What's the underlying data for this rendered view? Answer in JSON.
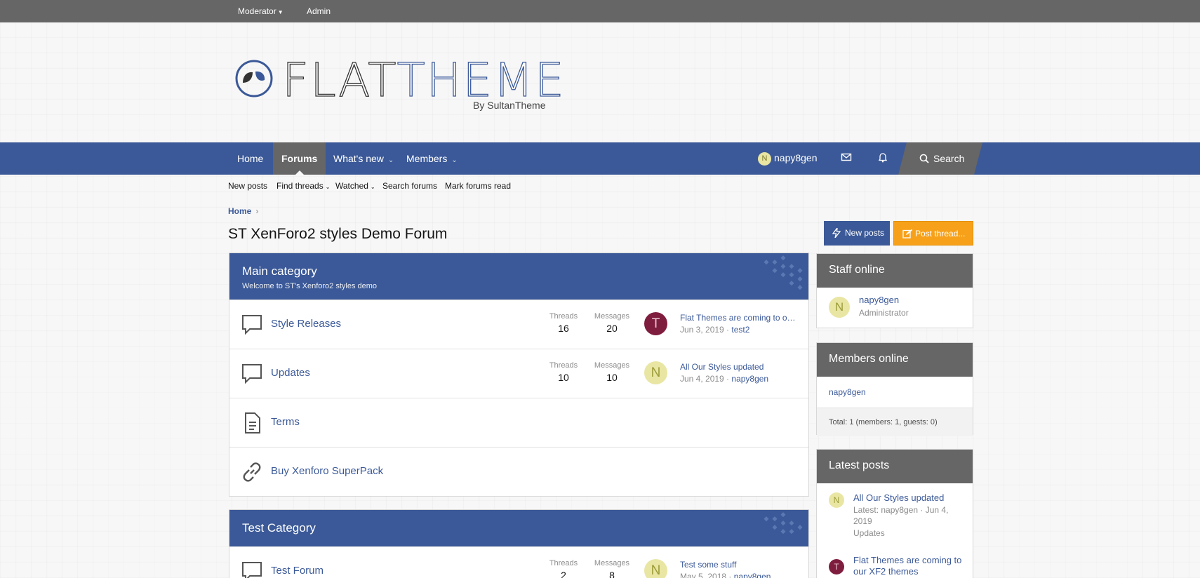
{
  "staff_bar": {
    "moderator": "Moderator",
    "admin": "Admin"
  },
  "logo": {
    "flat": "FLAT",
    "theme": "THEME",
    "byline": "By SultanTheme"
  },
  "nav": {
    "tabs": [
      {
        "label": "Home"
      },
      {
        "label": "Forums"
      },
      {
        "label": "What's new"
      },
      {
        "label": "Members"
      }
    ],
    "user_initial": "N",
    "username": "napy8gen",
    "search_label": "Search"
  },
  "subnav": [
    "New posts",
    "Find threads",
    "Watched",
    "Search forums",
    "Mark forums read"
  ],
  "breadcrumb": {
    "home": "Home"
  },
  "page_title": "ST XenForo2 styles Demo Forum",
  "buttons": {
    "new_posts": "New posts",
    "post_thread": "Post thread..."
  },
  "stat_labels": {
    "threads": "Threads",
    "messages": "Messages"
  },
  "categories": [
    {
      "title": "Main category",
      "description": "Welcome to ST's Xenforo2 styles demo",
      "nodes": [
        {
          "name": "Style Releases",
          "icon": "chat-bubble-icon",
          "threads": "16",
          "messages": "20",
          "avatar": "T",
          "latest_title": "Flat Themes are coming to our XF2 themes",
          "latest_date": "Jun 3, 2019",
          "latest_user": "test2"
        },
        {
          "name": "Updates",
          "icon": "chat-bubble-icon",
          "threads": "10",
          "messages": "10",
          "avatar": "N",
          "latest_title": "All Our Styles updated",
          "latest_date": "Jun 4, 2019",
          "latest_user": "napy8gen"
        },
        {
          "name": "Terms",
          "icon": "document-icon"
        },
        {
          "name": "Buy Xenforo SuperPack",
          "icon": "link-icon"
        }
      ]
    },
    {
      "title": "Test Category",
      "nodes": [
        {
          "name": "Test Forum",
          "icon": "chat-bubble-icon",
          "threads": "2",
          "messages": "8",
          "avatar": "N",
          "latest_title": "Test some stuff",
          "latest_date": "May 5, 2018",
          "latest_user": "napy8gen"
        }
      ]
    }
  ],
  "sidebar": {
    "staff_online": {
      "title": "Staff online",
      "initial": "N",
      "name": "napy8gen",
      "role": "Administrator"
    },
    "members_online": {
      "title": "Members online",
      "member": "napy8gen",
      "total": "Total: 1 (members: 1, guests: 0)"
    },
    "latest_posts": {
      "title": "Latest posts",
      "items": [
        {
          "initial": "N",
          "title": "All Our Styles updated",
          "meta": "Latest: napy8gen · Jun 4, 2019",
          "forum": "Updates"
        },
        {
          "initial": "T",
          "title": "Flat Themes are coming to our XF2 themes"
        }
      ]
    }
  },
  "colors": {
    "accent": "#3b5998",
    "dark": "#666666",
    "orange": "#f7a11a"
  }
}
